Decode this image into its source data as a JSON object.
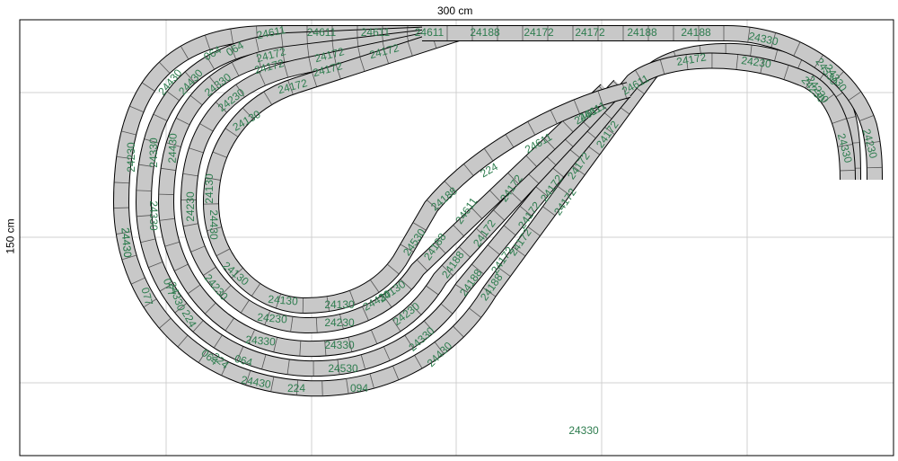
{
  "dimensions": {
    "width_label": "300 cm",
    "height_label": "150 cm"
  },
  "colors": {
    "track_fill": "#c8c8c8",
    "track_edge": "#000000",
    "label": "#2e7d4f",
    "grid": "#d0d0d0",
    "frame": "#000000"
  },
  "track_labels": [
    "24611",
    "24611",
    "24611",
    "24611",
    "24188",
    "24172",
    "24172",
    "24188",
    "24188",
    "24330",
    "064",
    "064",
    "24430",
    "24430",
    "24330",
    "24172",
    "24172",
    "24172",
    "24172",
    "24172",
    "24172",
    "24230",
    "24330",
    "24230",
    "24130",
    "24230",
    "24330",
    "24430",
    "24430",
    "24330",
    "24230",
    "24130",
    "24430",
    "24430",
    "24330",
    "24230",
    "24130",
    "24130",
    "24130",
    "24230",
    "24230",
    "24330",
    "24330",
    "077",
    "077",
    "224",
    "224",
    "064",
    "064",
    "24530",
    "24430",
    "224",
    "094",
    "24430",
    "24130",
    "24230",
    "24330",
    "24430",
    "24530",
    "24188",
    "24188",
    "24188",
    "24188",
    "24188",
    "224",
    "24611",
    "24611",
    "24611",
    "24611",
    "24611",
    "24172",
    "24172",
    "24172",
    "24172",
    "24172",
    "24172",
    "24172",
    "24172",
    "24172",
    "24172",
    "24230",
    "24230",
    "24330",
    "24330",
    "24230",
    "24330"
  ]
}
